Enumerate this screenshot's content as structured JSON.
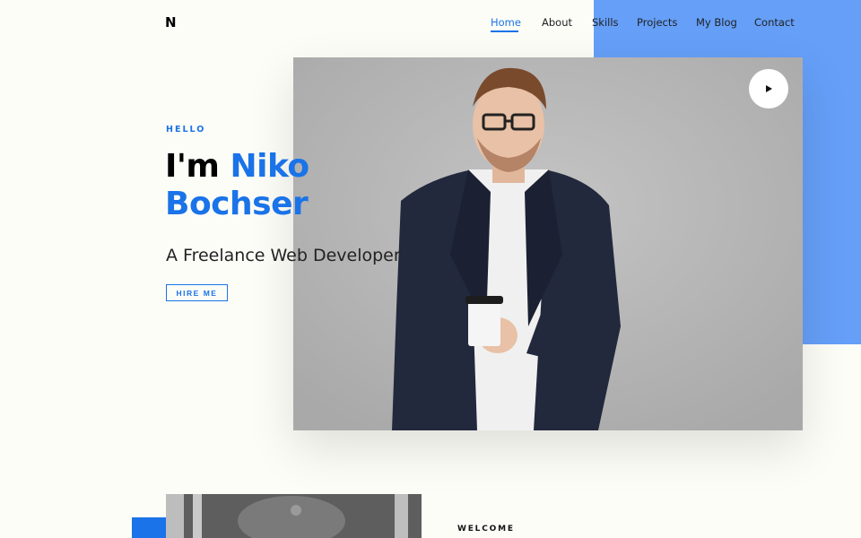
{
  "brand": {
    "logo": "N"
  },
  "nav": {
    "items": [
      {
        "label": "Home",
        "active": true
      },
      {
        "label": "About"
      },
      {
        "label": "Skills"
      },
      {
        "label": "Projects"
      },
      {
        "label": "My Blog"
      },
      {
        "label": "Contact"
      }
    ]
  },
  "hero": {
    "greeting": "HELLO",
    "intro": "I'm",
    "first_name": "Niko",
    "last_name": "Bochser",
    "subtitle": "A Freelance Web Developer",
    "cta_label": "HIRE ME"
  },
  "about": {
    "eyebrow": "WELCOME"
  },
  "colors": {
    "accent": "#1a73e8",
    "accent_block": "#659ff8",
    "background": "#fdfdf8"
  },
  "icons": {
    "play": "play-icon"
  }
}
